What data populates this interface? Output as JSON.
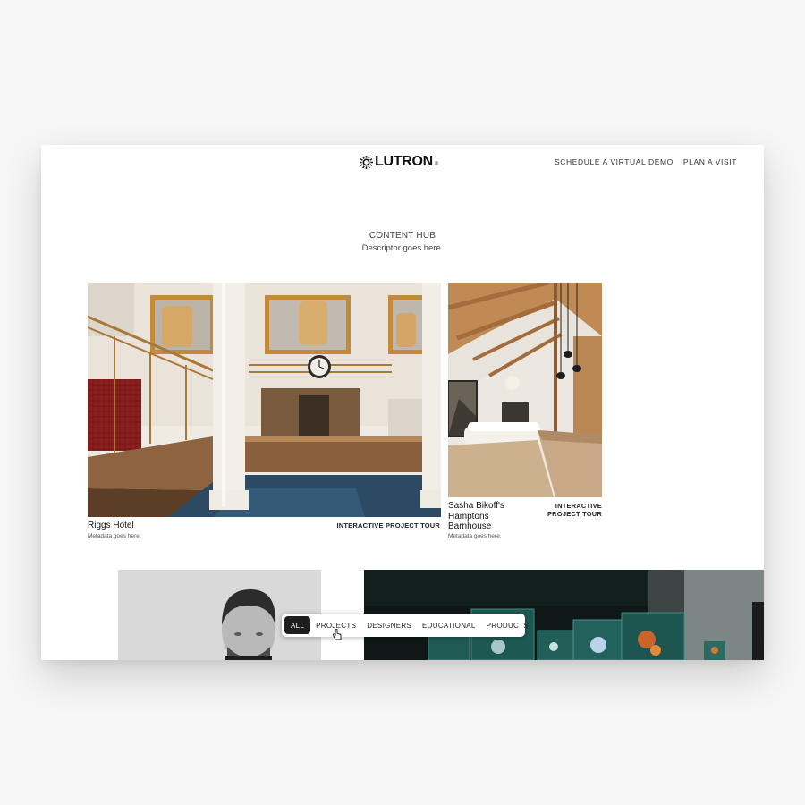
{
  "header": {
    "brand": "LUTRON",
    "brand_mark": "®",
    "nav": [
      "SCHEDULE A VIRTUAL DEMO",
      "PLAN A VISIT"
    ]
  },
  "hub": {
    "title": "CONTENT HUB",
    "descriptor": "Descriptor goes here."
  },
  "cards": [
    {
      "title": "Riggs Hotel",
      "tag": "INTERACTIVE PROJECT TOUR",
      "meta": "Metadata goes here."
    },
    {
      "title": "Sasha Bikoff's Hamptons Barnhouse",
      "tag_line1": "INTERACTIVE",
      "tag_line2": "PROJECT TOUR",
      "meta": "Metadata goes here."
    }
  ],
  "filters": {
    "items": [
      "ALL",
      "PROJECTS",
      "DESIGNERS",
      "EDUCATIONAL",
      "PRODUCTS"
    ],
    "selected": "ALL"
  },
  "colors": {
    "page_bg": "#f6f6f6",
    "active_filter": "#1e1e1e"
  }
}
